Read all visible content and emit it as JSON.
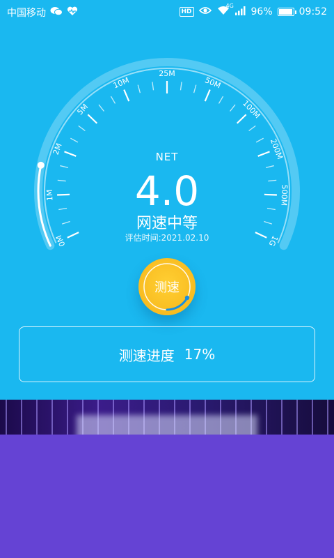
{
  "status_bar": {
    "carrier": "中国移动",
    "battery_percent": "96%",
    "battery_level": 0.96,
    "time": "09:52",
    "hd_badge": "HD",
    "network_badge": "4G",
    "icons": [
      "wechat-icon",
      "health-icon",
      "eye-icon",
      "wifi-icon",
      "signal-icon",
      "battery-icon"
    ]
  },
  "gauge": {
    "scale_labels": [
      "0M",
      "1M",
      "2M",
      "5M",
      "10M",
      "25M",
      "50M",
      "100M",
      "200M",
      "500M",
      "1G"
    ],
    "label": "NET",
    "value": "4.0",
    "status": "网速中等",
    "eval_time": "评估时间:2021.02.10",
    "indicator_fraction": 0.3
  },
  "test_button": {
    "label": "测速"
  },
  "progress": {
    "label": "测速进度",
    "value": "17%"
  },
  "colors": {
    "background": "#1ab8f0",
    "button": "#f6b418",
    "ad_background": "#6543d4"
  }
}
